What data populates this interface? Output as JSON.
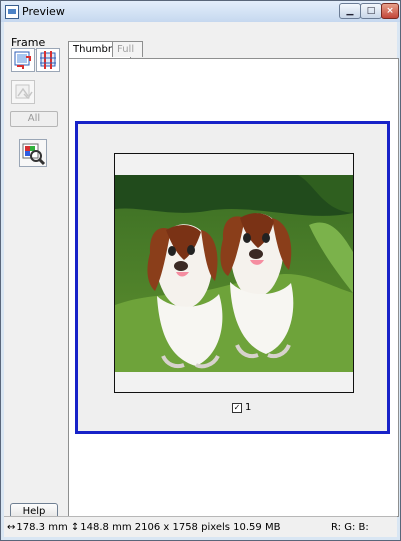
{
  "window": {
    "title": "Preview"
  },
  "sidebar": {
    "frame_label": "Frame",
    "all_button": "All",
    "help_button": "Help"
  },
  "tabs": [
    {
      "label": "Thumbnail",
      "active": true
    },
    {
      "label": "Full Size",
      "active": false
    }
  ],
  "preview": {
    "frame_number": "1",
    "frame_checked": true
  },
  "status": {
    "width_text": "178.3 mm",
    "height_text": "148.8 mm",
    "pixels_text": "2106 x 1758 pixels 10.59 MB",
    "rgb_text": "R: G: B:"
  },
  "colors": {
    "selection_border": "#1722c8",
    "titlebar_top": "#e3eefb",
    "titlebar_bottom": "#c6d8ef"
  },
  "icons": {
    "auto_locate": "auto-locate-icon",
    "marquee": "marquee-icon",
    "disabled": "disabled-icon",
    "zoom": "zoom-icon"
  }
}
